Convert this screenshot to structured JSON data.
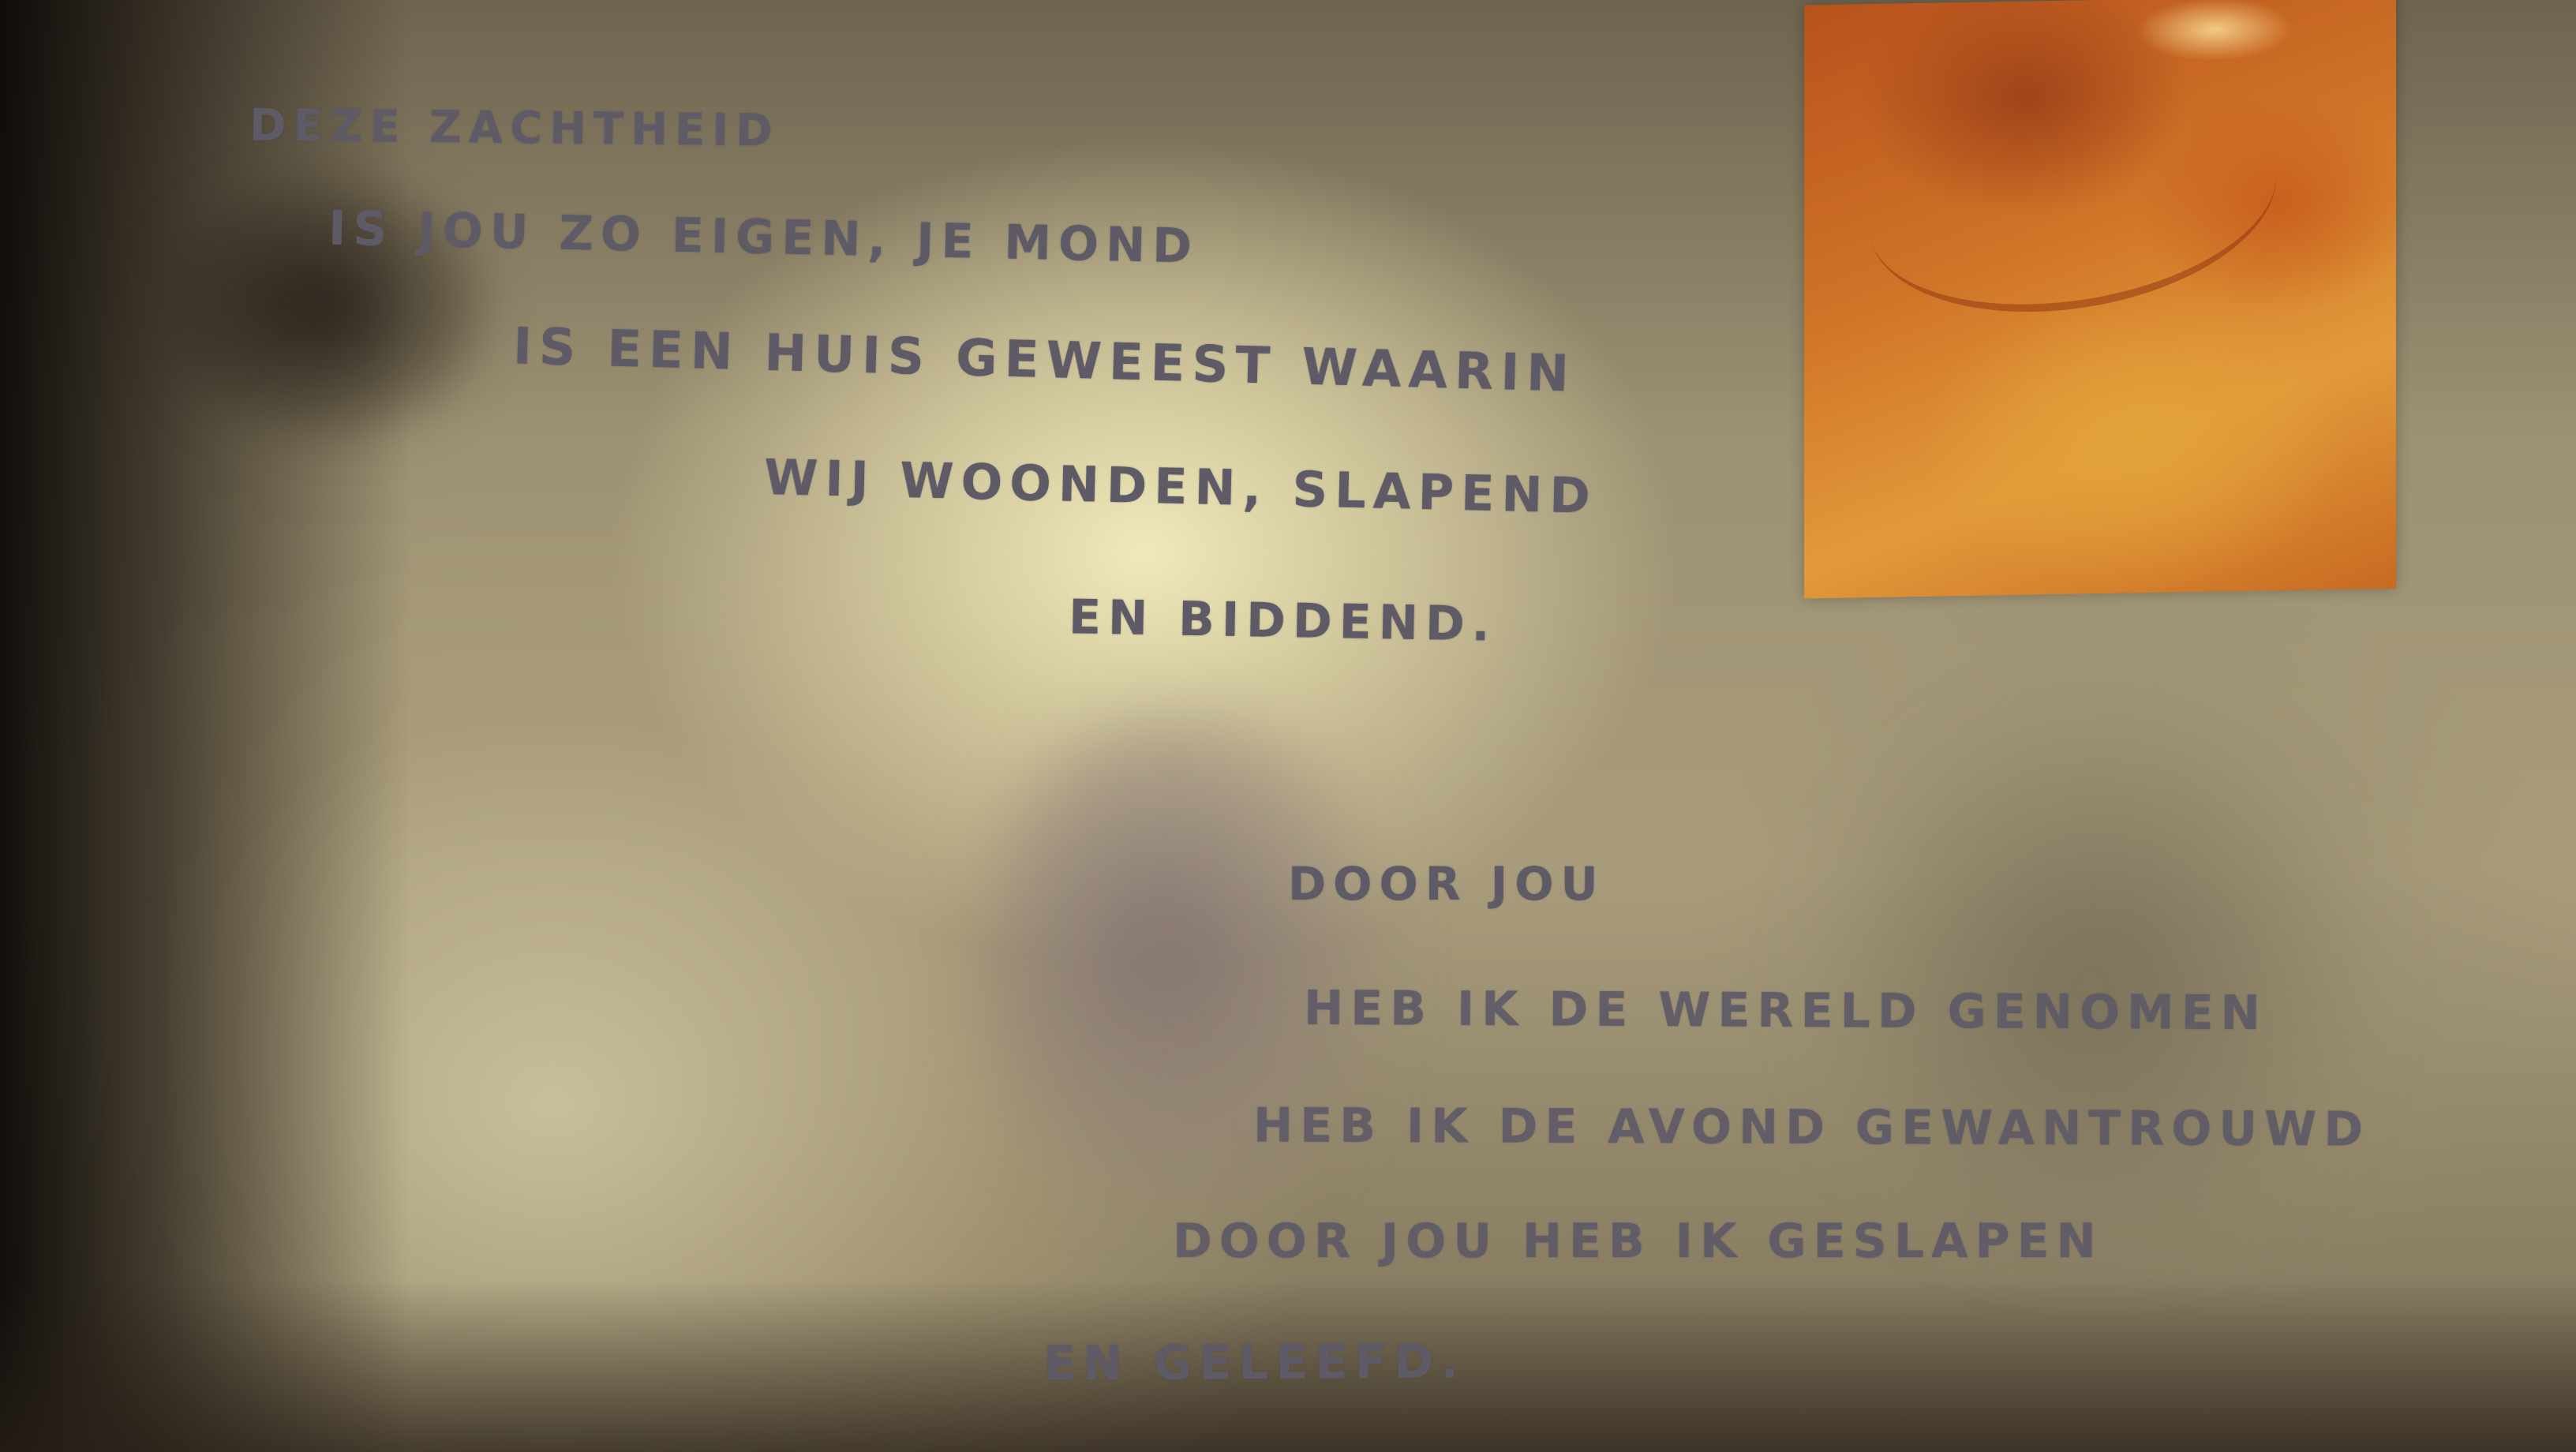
{
  "poem": {
    "stanza1": [
      "DEZE ZACHTHEID",
      "IS JOU ZO EIGEN, JE MOND",
      "IS EEN HUIS GEWEEST WAARIN",
      "WIJ WOONDEN, SLAPEND",
      "EN BIDDEND."
    ],
    "stanza2": [
      "DOOR JOU",
      "HEB IK DE WERELD GENOMEN",
      "HEB IK DE AVOND GEWANTROUWD",
      "DOOR JOU HEB IK GESLAPEN",
      "EN GELEEFD."
    ]
  },
  "colors": {
    "text": "#5e5a66",
    "inset_photo": "#d07428",
    "paper_highlight": "#f4eebe"
  }
}
